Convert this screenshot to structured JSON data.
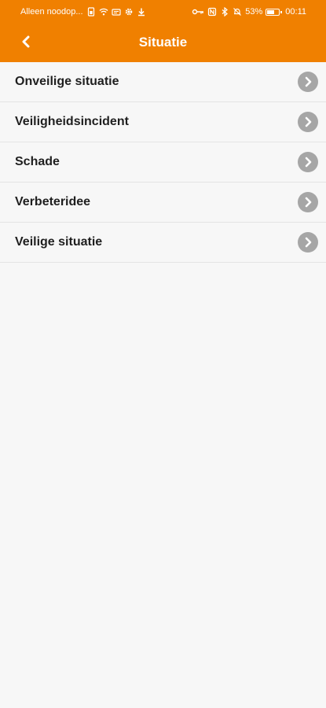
{
  "status_bar": {
    "left_text": "Alleen noodop...",
    "battery": "53%",
    "time": "00:11"
  },
  "header": {
    "title": "Situatie",
    "background_color": "#f08000"
  },
  "list": {
    "items": [
      {
        "label": "Onveilige situatie"
      },
      {
        "label": "Veiligheidsincident"
      },
      {
        "label": "Schade"
      },
      {
        "label": "Verbeteridee"
      },
      {
        "label": "Veilige situatie"
      }
    ]
  },
  "icons": {
    "back": "chevron-left-icon",
    "row_action": "chevron-right-circle-icon"
  }
}
